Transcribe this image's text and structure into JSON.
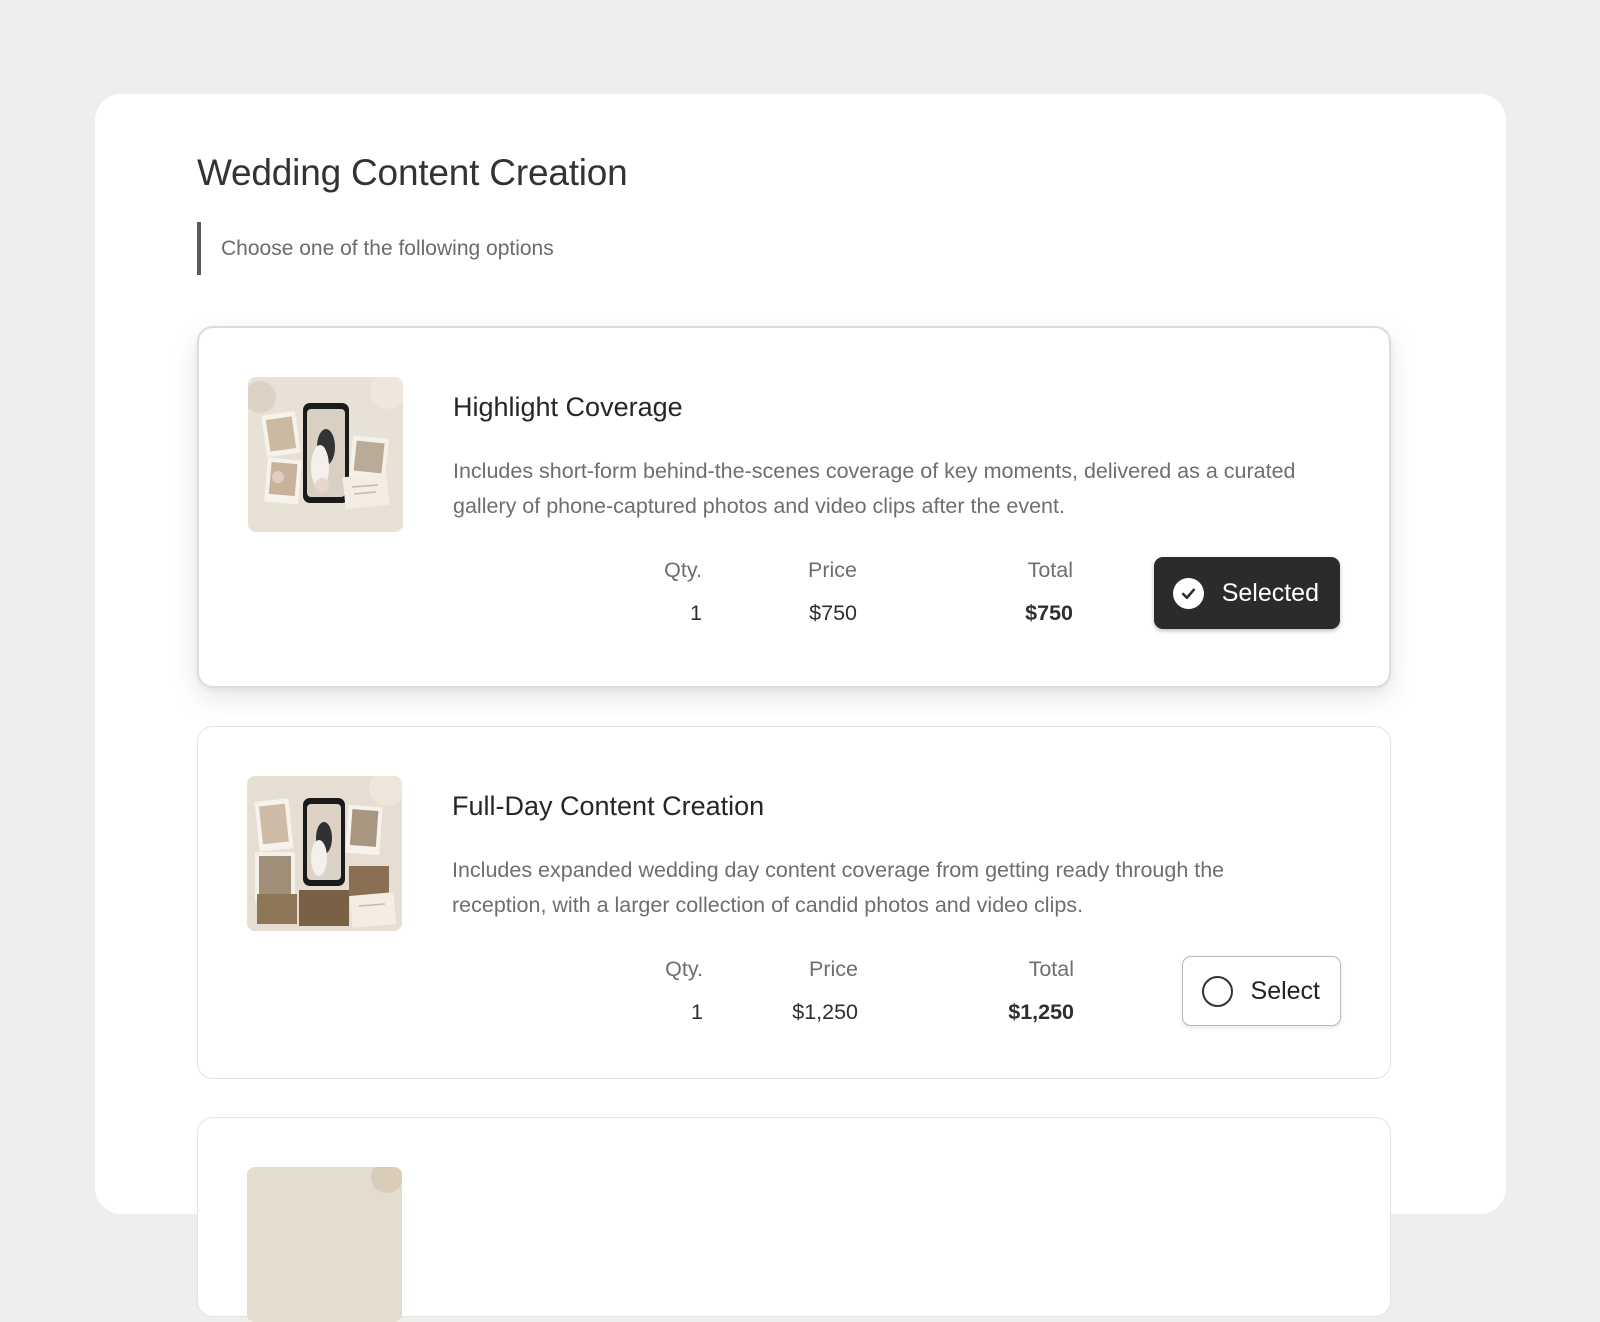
{
  "header": {
    "title": "Wedding Content Creation",
    "subtitle": "Choose one of the following options"
  },
  "labels": {
    "qty": "Qty.",
    "price": "Price",
    "total": "Total"
  },
  "options": [
    {
      "title": "Highlight Coverage",
      "description": "Includes short-form behind-the-scenes coverage of key moments, delivered as a curated gallery of phone-captured photos and video clips after the event.",
      "qty": "1",
      "price": "$750",
      "total": "$750",
      "button_label": "Selected",
      "selected": true,
      "thumbnail_icon": "wedding-phone-collage-image"
    },
    {
      "title": "Full-Day Content Creation",
      "description": "Includes expanded wedding day content coverage from getting ready through the reception, with a larger collection of candid photos and video clips.",
      "qty": "1",
      "price": "$1,250",
      "total": "$1,250",
      "button_label": "Select",
      "selected": false,
      "thumbnail_icon": "wedding-photo-collage-image"
    }
  ],
  "colors": {
    "background": "#efeeec",
    "card": "#ffffff",
    "selected_button": "#2b2b2b"
  }
}
